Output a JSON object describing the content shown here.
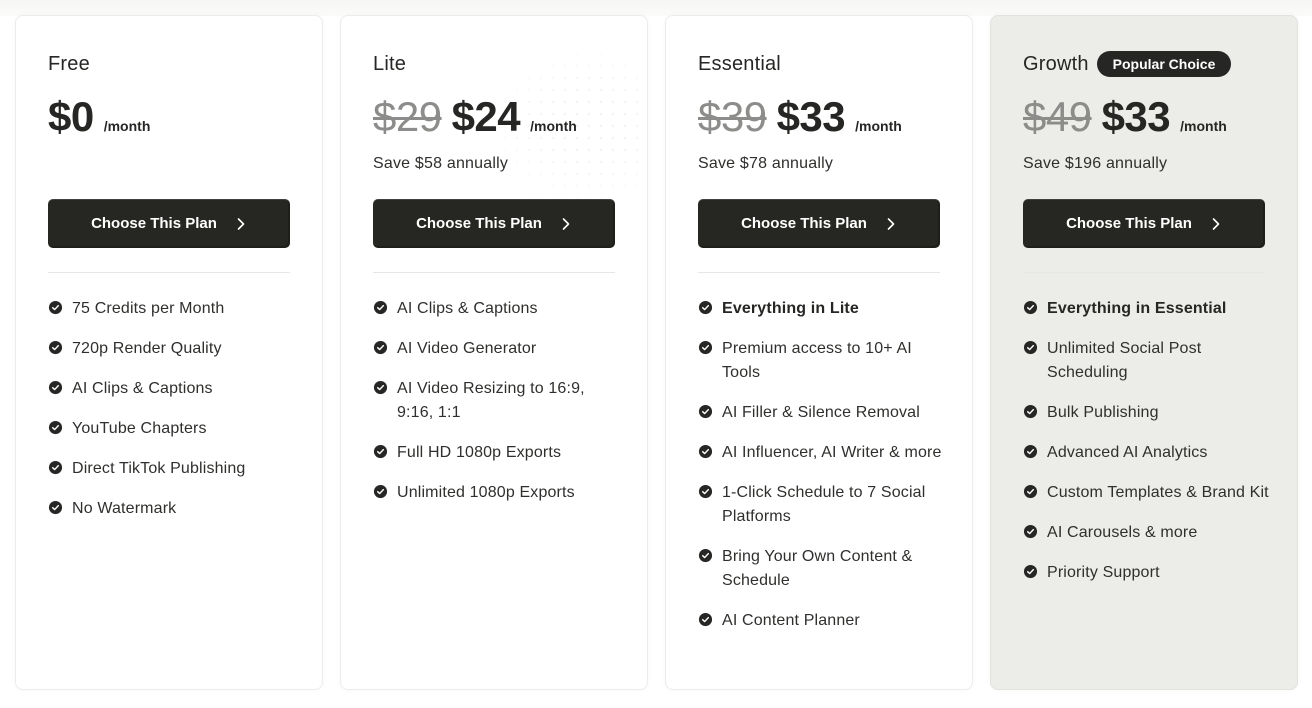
{
  "plans": [
    {
      "name": "Free",
      "badge": null,
      "old_price": null,
      "price": "$0",
      "period": "/month",
      "save_text": "",
      "cta_label": "Choose This Plan",
      "features": [
        {
          "text": "75 Credits per Month",
          "bold": false
        },
        {
          "text": "720p Render Quality",
          "bold": false
        },
        {
          "text": "AI Clips & Captions",
          "bold": false
        },
        {
          "text": "YouTube Chapters",
          "bold": false
        },
        {
          "text": "Direct TikTok Publishing",
          "bold": false
        },
        {
          "text": "No Watermark",
          "bold": false
        }
      ]
    },
    {
      "name": "Lite",
      "badge": null,
      "old_price": "$29",
      "price": "$24",
      "period": "/month",
      "save_text": "Save $58 annually",
      "cta_label": "Choose This Plan",
      "features": [
        {
          "text": "AI Clips & Captions",
          "bold": false
        },
        {
          "text": "AI Video Generator",
          "bold": false
        },
        {
          "text": "AI Video Resizing to 16:9, 9:16, 1:1",
          "bold": false
        },
        {
          "text": "Full HD 1080p Exports",
          "bold": false
        },
        {
          "text": "Unlimited 1080p Exports",
          "bold": false
        }
      ]
    },
    {
      "name": "Essential",
      "badge": null,
      "old_price": "$39",
      "price": "$33",
      "period": "/month",
      "save_text": "Save $78 annually",
      "cta_label": "Choose This Plan",
      "features": [
        {
          "text": "Everything in Lite",
          "bold": true
        },
        {
          "text": "Premium access to 10+ AI Tools",
          "bold": false
        },
        {
          "text": "AI Filler & Silence Removal",
          "bold": false
        },
        {
          "text": "AI Influencer, AI Writer & more",
          "bold": false
        },
        {
          "text": "1-Click Schedule to 7 Social Platforms",
          "bold": false
        },
        {
          "text": "Bring Your Own Content & Schedule",
          "bold": false
        },
        {
          "text": "AI Content Planner",
          "bold": false
        }
      ]
    },
    {
      "name": "Growth",
      "badge": "Popular Choice",
      "old_price": "$49",
      "price": "$33",
      "period": "/month",
      "save_text": "Save $196 annually",
      "cta_label": "Choose This Plan",
      "features": [
        {
          "text": "Everything in Essential",
          "bold": true
        },
        {
          "text": "Unlimited Social Post Scheduling",
          "bold": false
        },
        {
          "text": "Bulk Publishing",
          "bold": false
        },
        {
          "text": "Advanced AI Analytics",
          "bold": false
        },
        {
          "text": "Custom Templates & Brand Kit",
          "bold": false
        },
        {
          "text": "AI Carousels & more",
          "bold": false
        },
        {
          "text": "Priority Support",
          "bold": false
        }
      ]
    }
  ],
  "icons": {
    "feature_bullet": "check-circle-icon",
    "cta_arrow": "chevron-right-icon"
  },
  "colors": {
    "primary_dark": "#262622",
    "featured_bg": "#ecece8",
    "strikethrough_gray": "#8c8c8a"
  }
}
